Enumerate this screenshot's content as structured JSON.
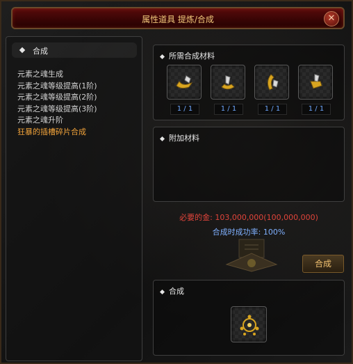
{
  "window": {
    "title": "属性道具 提炼/合成",
    "close_glyph": "✕"
  },
  "left_panel": {
    "header": "合成",
    "items": [
      {
        "label": "元素之魂生成",
        "active": false
      },
      {
        "label": "元素之魂等级提高(1阶)",
        "active": false
      },
      {
        "label": "元素之魂等级提高(2阶)",
        "active": false
      },
      {
        "label": "元素之魂等级提高(3阶)",
        "active": false
      },
      {
        "label": "元素之魂升阶",
        "active": false
      },
      {
        "label": "狂暴的插槽碎片合成",
        "active": true
      }
    ]
  },
  "materials": {
    "header": "所需合成材料",
    "slots": [
      {
        "icon": "fragment-icon",
        "count": "1 / 1"
      },
      {
        "icon": "fragment-icon",
        "count": "1 / 1"
      },
      {
        "icon": "fragment-icon",
        "count": "1 / 1"
      },
      {
        "icon": "fragment-icon",
        "count": "1 / 1"
      }
    ]
  },
  "extra": {
    "header": "附加材料"
  },
  "summary": {
    "gold_required": "必要的金: 103,000,000(100,000,000)",
    "success_rate": "合成时成功率: 100%",
    "gold_color": "#e0443a",
    "rate_color": "#7fb0ff"
  },
  "craft_button": "合成",
  "result": {
    "header": "合成",
    "icon": "socket-gem-icon"
  }
}
